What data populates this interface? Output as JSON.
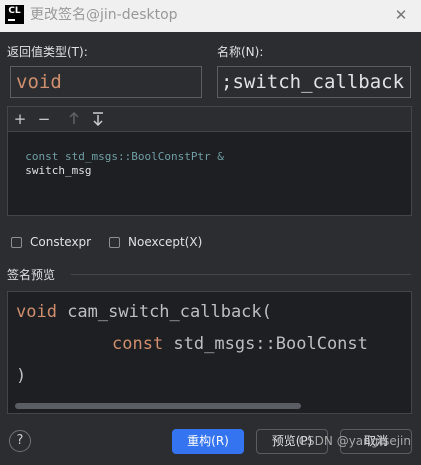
{
  "window": {
    "title": "更改签名@jin-desktop",
    "logo_text": "CL"
  },
  "form": {
    "return_type_label": "返回值类型(T):",
    "return_type_value": "void",
    "name_label": "名称(N):",
    "name_value": ";switch_callback"
  },
  "parameters": {
    "add_icon": "plus-icon",
    "remove_icon": "minus-icon",
    "move_up_icon": "arrow-up-icon",
    "move_down_icon": "arrow-down-icon",
    "row": {
      "type": "const std_msgs::BoolConstPtr &",
      "name": "switch_msg"
    }
  },
  "options": {
    "constexpr_label": "Constexpr",
    "noexcept_label": "Noexcept(X)"
  },
  "preview": {
    "section_label": "签名预览",
    "line1_kw": "void",
    "line1_rest": " cam_switch_callback(",
    "line2_kw": "const",
    "line2_rest": " std_msgs::BoolConst",
    "line3": ")"
  },
  "buttons": {
    "help": "?",
    "refactor": "重构(R)",
    "preview": "预览(P)",
    "cancel": "取消"
  },
  "watermark": "CSDN @yangtsejin",
  "colors": {
    "accent": "#3574f0",
    "keyword": "#cf8e6d",
    "type_text": "#6f9fa6"
  }
}
